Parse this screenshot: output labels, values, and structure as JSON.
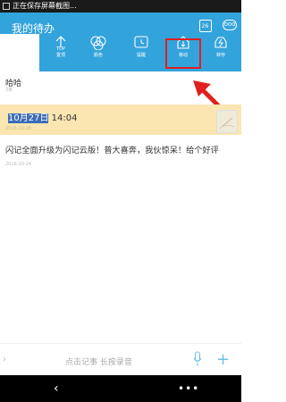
{
  "status_bar": {
    "text": "正在保存屏幕截图..."
  },
  "header": {
    "title": "我的待办",
    "calendar_day": "26",
    "more_label": "ooo"
  },
  "toolbar": {
    "items": [
      {
        "label": "置顶",
        "icon": "top-icon"
      },
      {
        "label": "颜色",
        "icon": "color-icon"
      },
      {
        "label": "提醒",
        "icon": "alarm-icon"
      },
      {
        "label": "移动",
        "icon": "move-icon"
      },
      {
        "label": "转存",
        "icon": "save-transfer-icon"
      }
    ]
  },
  "section": {
    "title": "哈哈",
    "subtitle": "3条"
  },
  "notes": [
    {
      "time_highlight": "10月27日",
      "time_rest": " 14:04",
      "date": "2016-10-26",
      "bg": "#fbe6b2"
    },
    {
      "text": "闪记全面升级为闪记云版！普大喜奔，我伙惊呆！给个好评",
      "date": "2016-10-24"
    }
  ],
  "bottom_bar": {
    "hint": "点击记事  长按录音"
  },
  "colors": {
    "accent": "#33a3dc",
    "highlight_box": "#e0201f",
    "arrow": "#e0201f"
  }
}
